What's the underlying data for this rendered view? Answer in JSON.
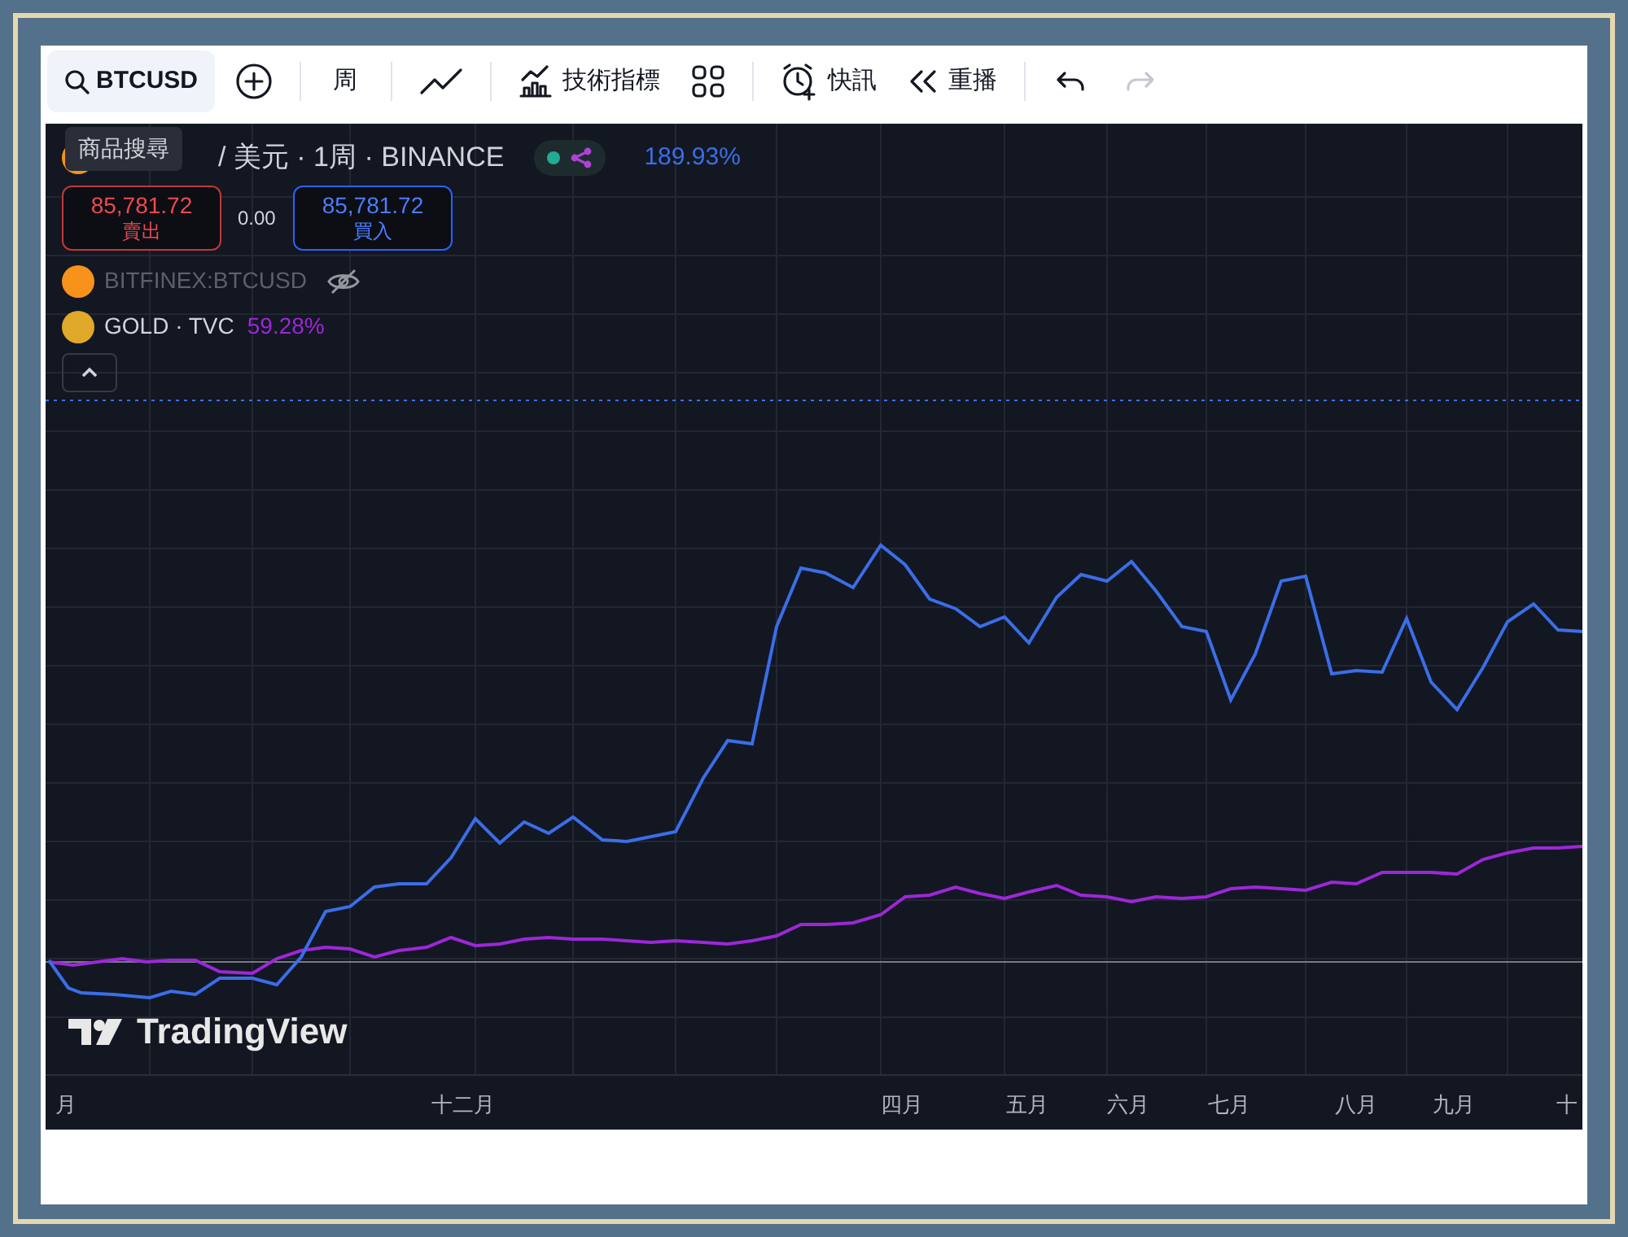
{
  "toolbar": {
    "items": [
      {
        "kind": "symbol",
        "label": "BTCUSD"
      },
      {
        "kind": "add"
      },
      {
        "kind": "interval",
        "label": "周"
      },
      {
        "kind": "chart-type"
      },
      {
        "kind": "indicators",
        "label": "技術指標"
      },
      {
        "kind": "layout"
      },
      {
        "kind": "alert",
        "label": "快訊"
      },
      {
        "kind": "replay",
        "label": "重播"
      },
      {
        "kind": "undo",
        "disabled": false
      },
      {
        "kind": "redo",
        "disabled": true
      }
    ]
  },
  "tooltip": "商品搜尋",
  "legend": {
    "title": "/ 美元 · 1周 · BINANCE",
    "market_open": true,
    "change": "189.93%",
    "color": "#3a6ee8",
    "sell": {
      "price": "85,781.72",
      "label": "賣出"
    },
    "spread": "0.00",
    "buy": {
      "price": "85,781.72",
      "label": "買入"
    },
    "compare": [
      {
        "name": "BITFINEX:BTCUSD",
        "hidden": true
      },
      {
        "name": "GOLD · TVC",
        "change": "59.28%",
        "color": "#9c27d8",
        "hidden": false
      }
    ]
  },
  "watermark_logo": "TradingView",
  "x_axis": [
    "月",
    "十二月",
    "四月",
    "五月",
    "六月",
    "七月",
    "八月",
    "九月",
    "十"
  ]
}
